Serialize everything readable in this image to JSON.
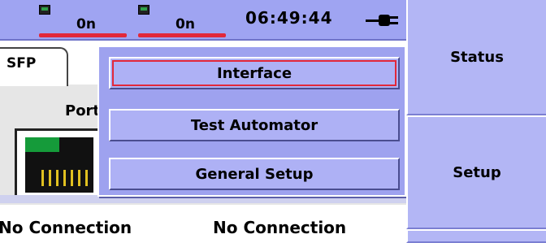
{
  "statusbar": {
    "port1_value": "0n",
    "port2_value": "0n",
    "time": "06:49:44"
  },
  "tab": {
    "label": "SFP"
  },
  "main": {
    "port_label": "Port",
    "connection_status_1": "No Connection",
    "connection_status_2": "No Connection"
  },
  "menu": {
    "items": [
      {
        "label": "Interface",
        "selected": true
      },
      {
        "label": "Test Automator",
        "selected": false
      },
      {
        "label": "General Setup",
        "selected": false
      }
    ]
  },
  "softkeys": [
    {
      "label": "Status"
    },
    {
      "label": "Setup"
    },
    {
      "label": ""
    }
  ],
  "colors": {
    "accent": "#9fa4f2",
    "selection_outline": "#e2283a",
    "link_led": "#159b3a"
  }
}
